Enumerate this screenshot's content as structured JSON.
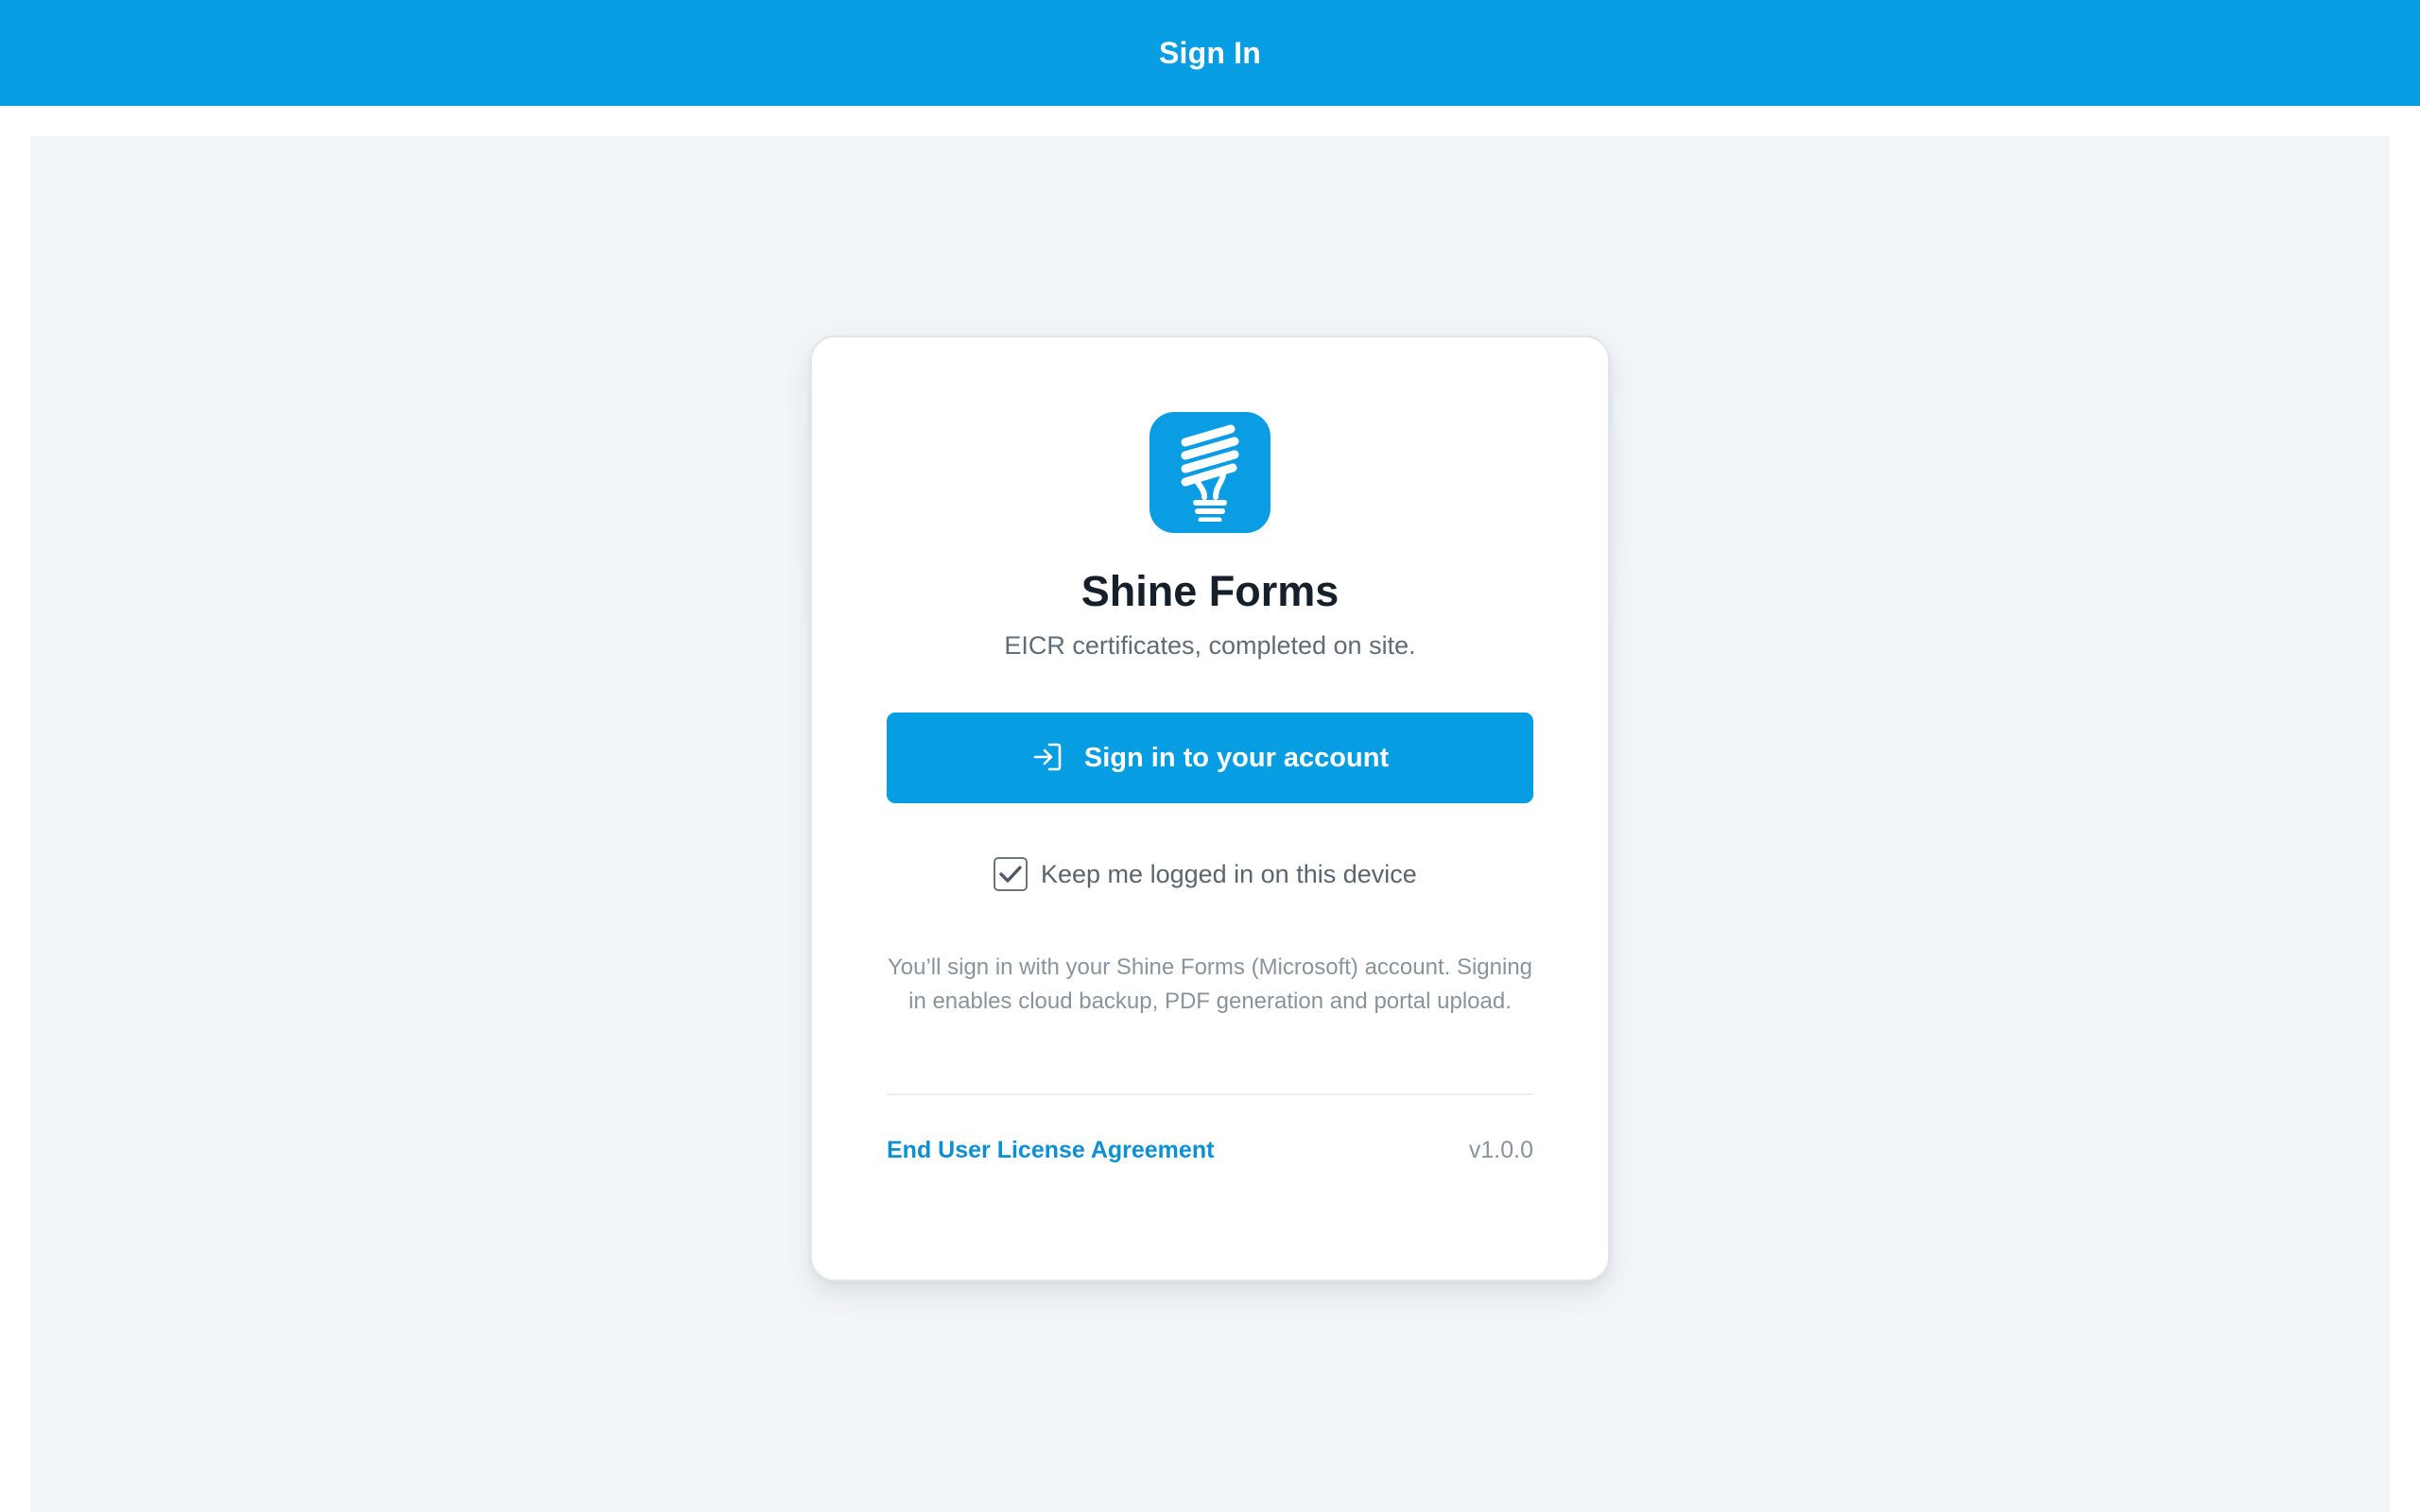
{
  "header": {
    "title": "Sign In"
  },
  "app": {
    "name": "Shine Forms",
    "tagline": "EICR certificates, completed on site.",
    "logo_icon": "lightbulb-icon"
  },
  "signin": {
    "button_label": "Sign in to your account",
    "button_icon": "sign-in-icon"
  },
  "keep_logged_in": {
    "label": "Keep me logged in on this device",
    "checked": true
  },
  "info": {
    "text": "You’ll sign in with your Shine Forms (Microsoft) account. Signing in enables cloud backup, PDF generation and portal upload."
  },
  "footer": {
    "eula_label": "End User License Agreement",
    "version": "v1.0.0"
  },
  "colors": {
    "accent": "#069de3",
    "link": "#0c8fd3",
    "title_text": "#16202b",
    "muted_text": "#8a939c",
    "background": "#f3f6f9"
  }
}
